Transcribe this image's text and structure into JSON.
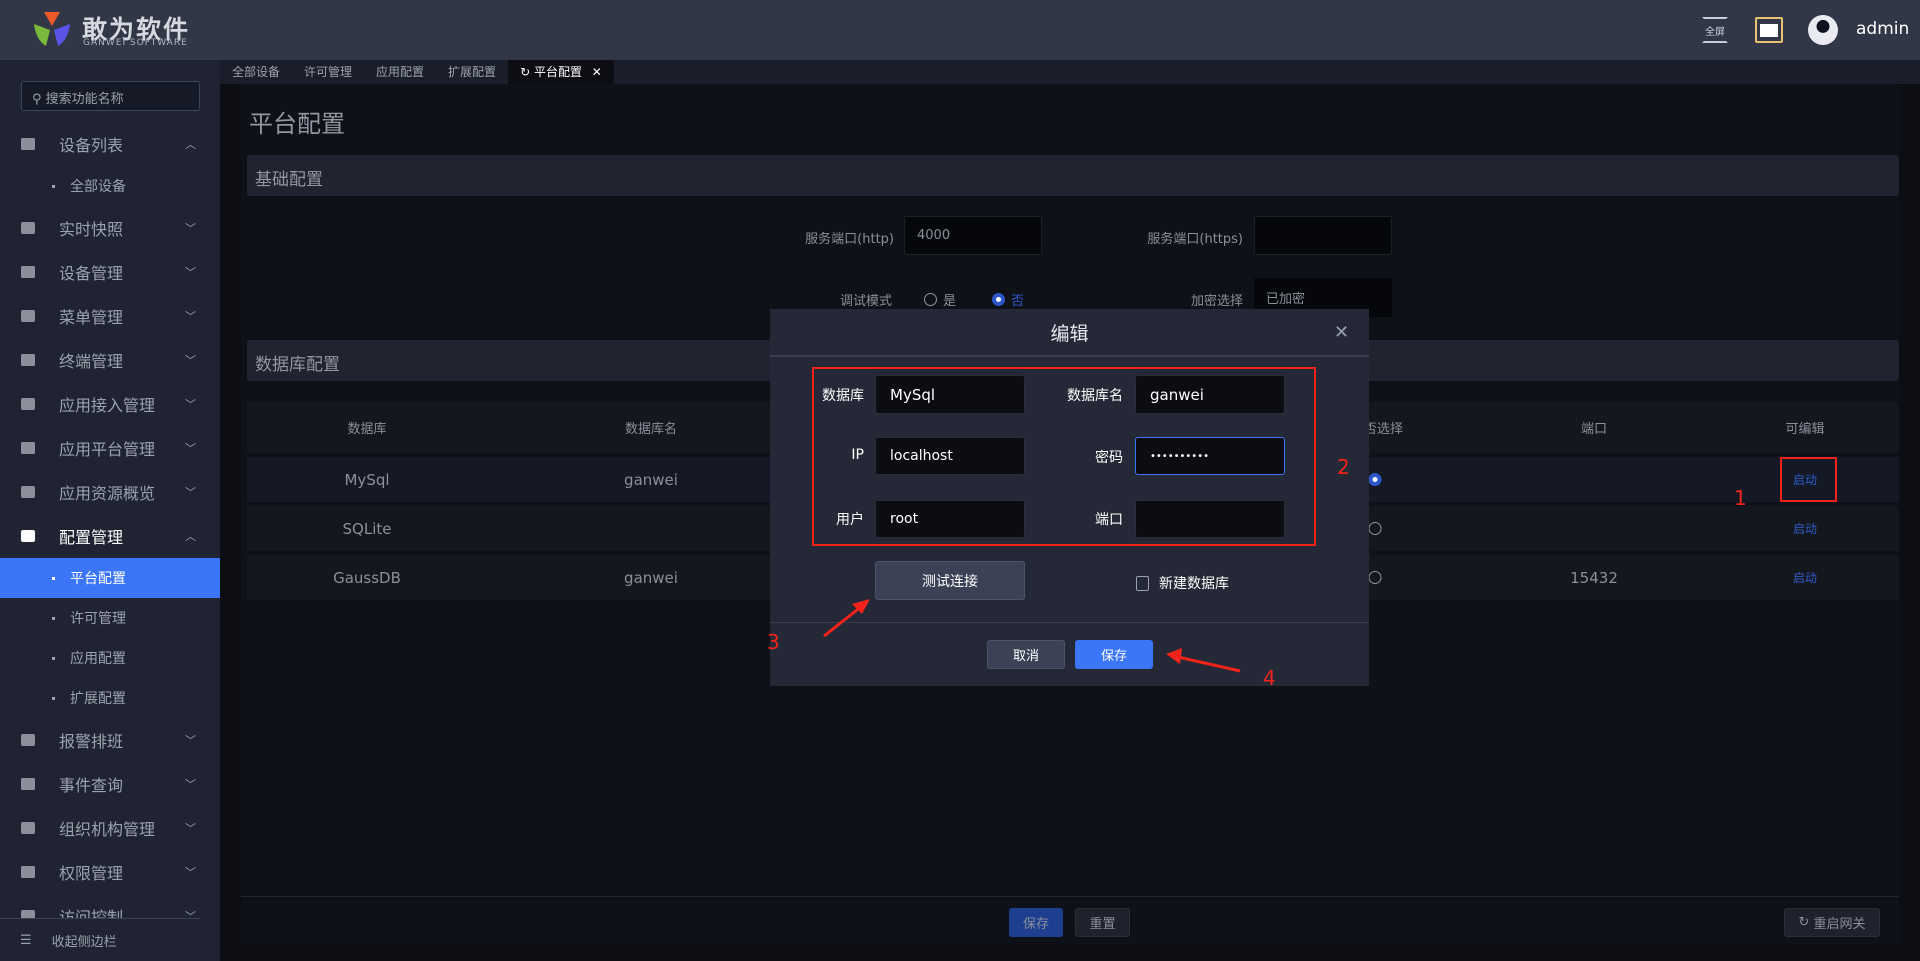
{
  "header": {
    "logo_cn": "敢为软件",
    "logo_en": "GANWEI SOFTWARE",
    "fullscreen_label": "全屏",
    "username": "admin"
  },
  "sidebar": {
    "search_placeholder": "搜索功能名称",
    "collapse_label": "收起侧边栏",
    "items": [
      {
        "type": "main",
        "label": "设备列表",
        "icon": "monitor-icon",
        "expanded": true
      },
      {
        "type": "sub",
        "label": "全部设备"
      },
      {
        "type": "main",
        "label": "实时快照",
        "icon": "camera-icon"
      },
      {
        "type": "main",
        "label": "设备管理",
        "icon": "grid-icon"
      },
      {
        "type": "main",
        "label": "菜单管理",
        "icon": "table-icon"
      },
      {
        "type": "main",
        "label": "终端管理",
        "icon": "grid-icon"
      },
      {
        "type": "main",
        "label": "应用接入管理",
        "icon": "grid-icon"
      },
      {
        "type": "main",
        "label": "应用平台管理",
        "icon": "grid-icon"
      },
      {
        "type": "main",
        "label": "应用资源概览",
        "icon": "grid-icon"
      },
      {
        "type": "main",
        "label": "配置管理",
        "icon": "bookmark-icon",
        "expanded": true,
        "open": true
      },
      {
        "type": "sub",
        "label": "平台配置",
        "active": true
      },
      {
        "type": "sub",
        "label": "许可管理"
      },
      {
        "type": "sub",
        "label": "应用配置"
      },
      {
        "type": "sub",
        "label": "扩展配置"
      },
      {
        "type": "main",
        "label": "报警排班",
        "icon": "calendar-icon"
      },
      {
        "type": "main",
        "label": "事件查询",
        "icon": "search-doc-icon"
      },
      {
        "type": "main",
        "label": "组织机构管理",
        "icon": "gear-icon"
      },
      {
        "type": "main",
        "label": "权限管理",
        "icon": "shield-icon"
      },
      {
        "type": "main",
        "label": "访问控制",
        "icon": "door-icon"
      }
    ]
  },
  "tabs": [
    {
      "label": "全部设备"
    },
    {
      "label": "许可管理"
    },
    {
      "label": "应用配置"
    },
    {
      "label": "扩展配置"
    },
    {
      "label": "平台配置",
      "active": true,
      "close": "✕"
    }
  ],
  "page": {
    "title": "平台配置",
    "basic": {
      "title": "基础配置",
      "http_label": "服务端口(http)",
      "http_value": "4000",
      "https_label": "服务端口(https)",
      "https_value": "",
      "debug_label": "调试模式",
      "debug_yes": "是",
      "debug_no": "否",
      "debug_selected": "否",
      "encrypt_label": "加密选择",
      "encrypt_value": "已加密"
    },
    "database": {
      "title": "数据库配置",
      "columns": [
        "数据库",
        "数据库名",
        "是否选择",
        "端口",
        "可编辑"
      ],
      "rows": [
        {
          "db": "MySql",
          "name": "ganwei",
          "selected": true,
          "port": "",
          "action": "启动"
        },
        {
          "db": "SQLite",
          "name": "",
          "selected": false,
          "port": "",
          "action": "启动"
        },
        {
          "db": "GaussDB",
          "name": "ganwei",
          "selected": false,
          "port": "15432",
          "action": "启动"
        }
      ]
    },
    "save": "保存",
    "reset": "重置",
    "restart": "重启网关"
  },
  "dialog": {
    "title": "编辑",
    "db_label": "数据库",
    "db_value": "MySql",
    "dbname_label": "数据库名",
    "dbname_value": "ganwei",
    "ip_label": "IP",
    "ip_value": "localhost",
    "password_label": "密码",
    "password_value": "••••••••••",
    "user_label": "用户",
    "user_value": "root",
    "port_label": "端口",
    "port_value": "",
    "test_button": "测试连接",
    "new_db_label": "新建数据库",
    "new_db_checked": false,
    "cancel": "取消",
    "save": "保存"
  },
  "annotations": {
    "a1": "1",
    "a2": "2",
    "a3": "3",
    "a4": "4",
    "color": "#f2231b"
  },
  "colors": {
    "accent": "#3a76f7",
    "header": "#323747",
    "sidebar": "#1f2332"
  }
}
